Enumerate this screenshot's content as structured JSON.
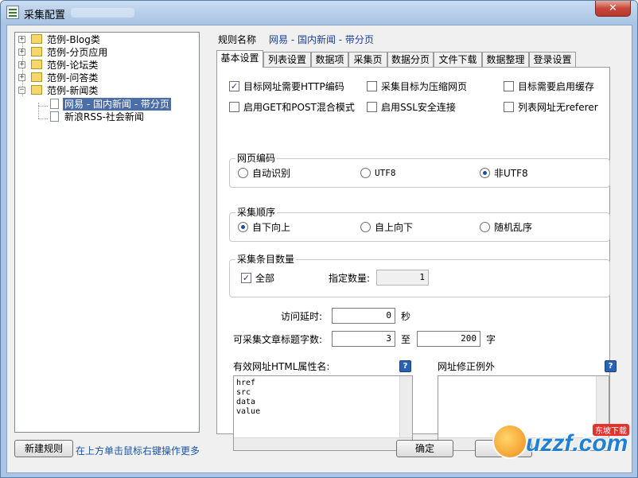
{
  "window": {
    "title": "采集配置",
    "close_glyph": "✕"
  },
  "tree": {
    "expand_glyph": "+",
    "collapse_glyph": "−",
    "items": [
      {
        "label": "范例-Blog类"
      },
      {
        "label": "范例-分页应用"
      },
      {
        "label": "范例-论坛类"
      },
      {
        "label": "范例-问答类"
      },
      {
        "label": "范例-新闻类"
      }
    ],
    "children": [
      {
        "label": "网易 - 国内新闻 - 带分页",
        "selected": true
      },
      {
        "label": "新浪RSS-社会新闻",
        "selected": false
      }
    ]
  },
  "footer": {
    "new_rule": "新建规则",
    "hint": "在上方单击鼠标右键操作更多",
    "ok": "确定",
    "cancel": ""
  },
  "rule": {
    "name_label": "规则名称",
    "name_value": "网易 - 国内新闻 - 带分页"
  },
  "tabs": [
    {
      "label": "基本设置",
      "active": true
    },
    {
      "label": "列表设置"
    },
    {
      "label": "数据项"
    },
    {
      "label": "采集页"
    },
    {
      "label": "数据分页"
    },
    {
      "label": "文件下载"
    },
    {
      "label": "数据整理"
    },
    {
      "label": "登录设置"
    }
  ],
  "options": {
    "row1": [
      {
        "label": "目标网址需要HTTP编码",
        "checked": true
      },
      {
        "label": "采集目标为压缩网页",
        "checked": false
      },
      {
        "label": "目标需要启用缓存",
        "checked": false
      }
    ],
    "row2": [
      {
        "label": "启用GET和POST混合模式",
        "checked": false
      },
      {
        "label": "启用SSL安全连接",
        "checked": false
      },
      {
        "label": "列表网址无referer",
        "checked": false
      }
    ]
  },
  "encoding": {
    "title": "网页编码",
    "options": [
      {
        "label": "自动识别",
        "selected": false
      },
      {
        "label": "UTF8",
        "selected": false
      },
      {
        "label": "非UTF8",
        "selected": true
      }
    ]
  },
  "order": {
    "title": "采集顺序",
    "options": [
      {
        "label": "自下向上",
        "selected": true
      },
      {
        "label": "自上向下",
        "selected": false
      },
      {
        "label": "随机乱序",
        "selected": false
      }
    ]
  },
  "count": {
    "title": "采集条目数量",
    "all_label": "全部",
    "all_checked": true,
    "specify_label": "指定数量:",
    "specify_value": "1"
  },
  "delay": {
    "label": "访问延时:",
    "value": "0",
    "unit": "秒"
  },
  "title_len": {
    "label": "可采集文章标题字数:",
    "min": "3",
    "to": "至",
    "max": "200",
    "unit": "字"
  },
  "html_attr": {
    "label": "有效网址HTML属性名:",
    "content": "href\nsrc\ndata\nvalue"
  },
  "url_fix": {
    "label": "网址修正例外",
    "content": ""
  },
  "help_glyph": "?",
  "watermark": {
    "text": "uzzf.com",
    "badge": "东坡下载"
  }
}
